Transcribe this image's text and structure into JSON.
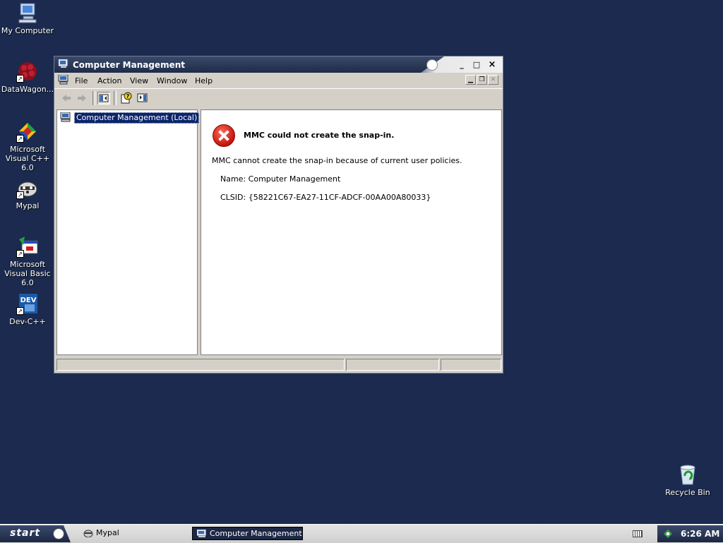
{
  "desktop": {
    "icons": [
      {
        "label": "My Computer"
      },
      {
        "label": "DataWagon..."
      },
      {
        "label": "Microsoft Visual C++ 6.0"
      },
      {
        "label": "Mypal"
      },
      {
        "label": "Microsoft Visual Basic 6.0"
      },
      {
        "label": "Dev-C++"
      },
      {
        "label": "Recycle Bin"
      }
    ]
  },
  "window": {
    "title": "Computer Management",
    "controls": {
      "minimize": "_",
      "maximize": "□",
      "close": "×"
    },
    "menu": [
      "File",
      "Action",
      "View",
      "Window",
      "Help"
    ],
    "tree": {
      "root": "Computer Management (Local)"
    },
    "error": {
      "heading": "MMC could not create the snap-in.",
      "message": "MMC cannot create the snap-in because of current user policies.",
      "name": "Name: Computer Management",
      "clsid": "CLSID: {58221C67-EA27-11CF-ADCF-00AA00A80033}"
    }
  },
  "taskbar": {
    "start_label": "start",
    "tasks": [
      {
        "label": "Mypal",
        "active": false
      },
      {
        "label": "Computer Management",
        "active": true
      }
    ],
    "clock": "6:26 AM"
  },
  "colors": {
    "desktop_bg": "#1b2a4e",
    "title_dark": "#1e2b48",
    "selection": "#0a246a",
    "error_red": "#c4140c"
  }
}
